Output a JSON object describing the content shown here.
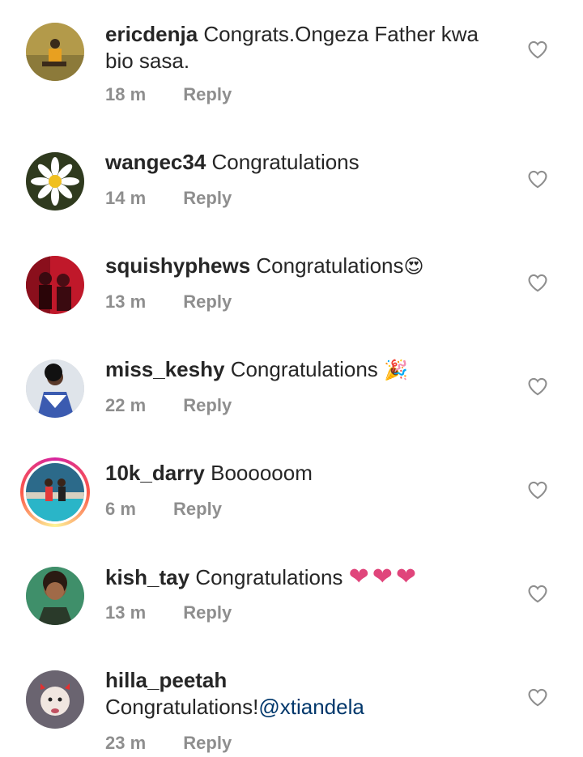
{
  "reply_label": "Reply",
  "comments": [
    {
      "username": "ericdenja",
      "text": "Congrats.Ongeza  Father kwa bio sasa.",
      "time": "18 m"
    },
    {
      "username": "wangec34",
      "text": "Congratulations",
      "time": "14 m"
    },
    {
      "username": "squishyphews",
      "text": "Congratulations",
      "emoji": "😍",
      "time": "13 m"
    },
    {
      "username": "miss_keshy",
      "text": "Congratulations ",
      "emoji": "🎉",
      "time": "22 m"
    },
    {
      "username": "10k_darry",
      "text": "Boooooom",
      "time": "6 m"
    },
    {
      "username": "kish_tay",
      "text": "Congratulations ",
      "emoji": "❤❤❤",
      "time": "13 m"
    },
    {
      "username": "hilla_peetah",
      "text": "Congratulations!",
      "mention": "@xtiandela",
      "time": "23 m"
    }
  ],
  "colors": {
    "text": "#262626",
    "meta": "#8e8e8e",
    "mention": "#00376b",
    "heart": "#e0457b"
  },
  "icons": {
    "like": "heart-outline-icon"
  }
}
